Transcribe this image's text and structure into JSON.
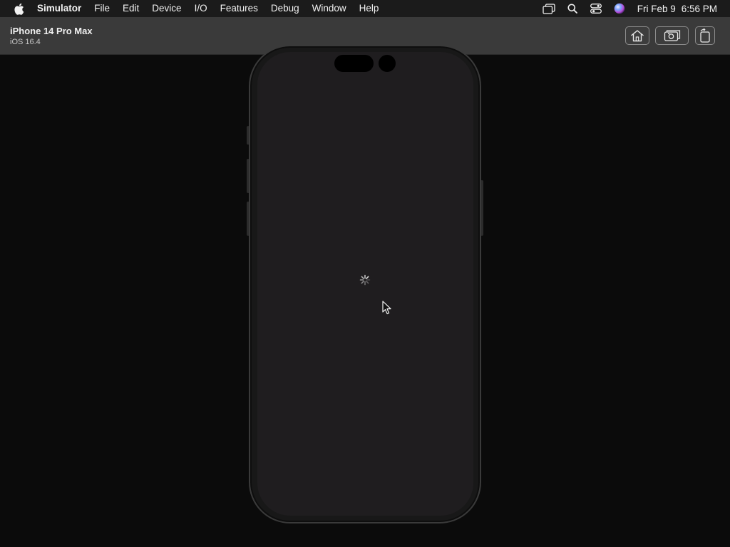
{
  "menubar": {
    "apple_icon": "apple-logo-icon",
    "app_name": "Simulator",
    "items": [
      "File",
      "Edit",
      "Device",
      "I/O",
      "Features",
      "Debug",
      "Window",
      "Help"
    ],
    "status_icons": [
      "stage-manager-icon",
      "spotlight-search-icon",
      "control-center-icon",
      "siri-icon"
    ],
    "clock": {
      "date": "Fri Feb 9",
      "time": "6:56 PM"
    }
  },
  "titlebar": {
    "device_name": "iPhone 14 Pro Max",
    "os_version": "iOS 16.4",
    "buttons": [
      "home-icon",
      "screenshot-icon",
      "rotate-icon"
    ]
  },
  "device": {
    "screen_state": "loading",
    "indicator": "activity-spinner-icon"
  },
  "colors": {
    "menubar_bg": "#1b1b1b",
    "titlebar_bg": "#3a3a3a",
    "stage_bg": "#0b0b0b",
    "screen_bg": "#1f1d1f"
  }
}
